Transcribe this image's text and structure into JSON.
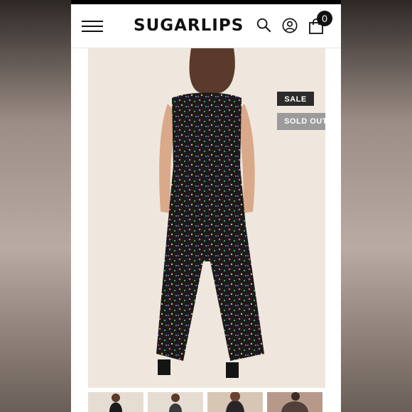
{
  "brand": {
    "name": "SUGARLIPS"
  },
  "header": {
    "menu_icon": "hamburger-menu-icon",
    "search_icon": "search-icon",
    "account_icon": "user-account-icon",
    "cart_icon": "shopping-bag-icon",
    "cart_count": "0"
  },
  "product": {
    "badges": {
      "sale": "SALE",
      "sold_out": "SOLD OUT"
    },
    "zoom_icon": "expand-icon",
    "thumbnail_count": 4
  },
  "colors": {
    "brand_text": "#111111",
    "sale_badge": "#2b2b2b",
    "sold_out_badge": "#9b9b9b",
    "image_background": "#efe7dd"
  }
}
